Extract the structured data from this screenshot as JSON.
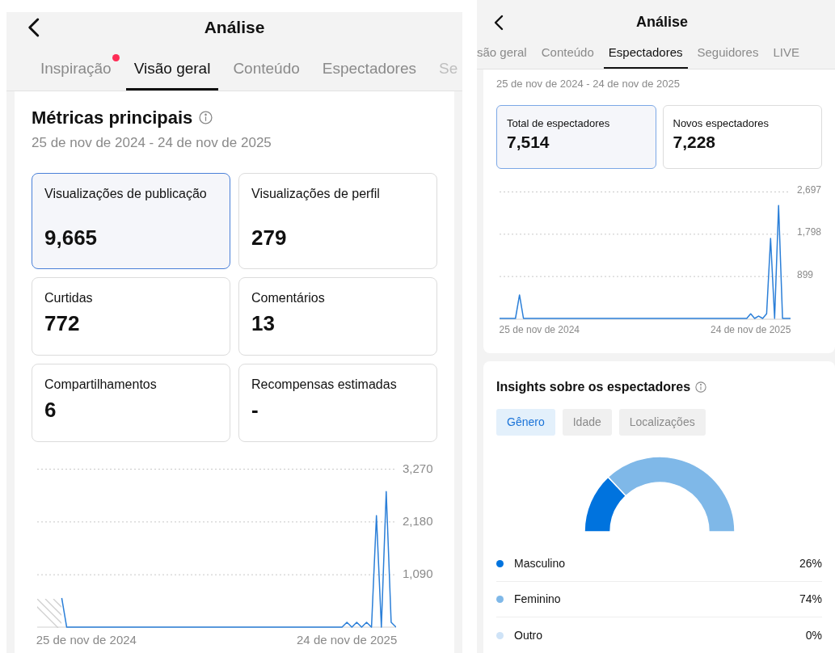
{
  "left_screen": {
    "header": {
      "title": "Análise"
    },
    "tabs": [
      {
        "label": "Inspiração",
        "selected": false,
        "badge": true
      },
      {
        "label": "Visão geral",
        "selected": true,
        "badge": false
      },
      {
        "label": "Conteúdo",
        "selected": false,
        "badge": false
      },
      {
        "label": "Espectadores",
        "selected": false,
        "badge": false
      },
      {
        "label": "Se",
        "selected": false,
        "badge": false
      }
    ],
    "section": {
      "title": "Métricas principais",
      "date_range": "25 de nov de 2024 - 24 de nov de 2025"
    },
    "metrics": [
      {
        "label": "Visualizações de publicação",
        "value": "9,665",
        "selected": true
      },
      {
        "label": "Visualizações de perfil",
        "value": "279",
        "selected": false
      },
      {
        "label": "Curtidas",
        "value": "772",
        "selected": false
      },
      {
        "label": "Comentários",
        "value": "13",
        "selected": false
      },
      {
        "label": "Compartilhamentos",
        "value": "6",
        "selected": false
      },
      {
        "label": "Recompensas estimadas",
        "value": "-",
        "selected": false
      }
    ],
    "chart_data": {
      "type": "line",
      "ylim": [
        0,
        3270
      ],
      "yticks": [
        {
          "value": 3270,
          "label": "3,270"
        },
        {
          "value": 2180,
          "label": "2,180"
        },
        {
          "value": 1090,
          "label": "1,090"
        }
      ],
      "categories": [
        null,
        null,
        null,
        null,
        null,
        null,
        null,
        null,
        null,
        null,
        "25 de nov de 2024",
        null,
        null,
        null,
        null,
        null,
        null,
        null,
        null,
        null,
        null,
        null,
        null,
        null,
        null,
        null,
        null,
        null,
        null,
        null,
        null,
        null,
        null,
        null,
        null,
        null,
        null,
        null,
        null,
        null,
        null,
        null,
        null,
        null,
        null,
        null,
        null,
        null,
        null,
        null,
        null,
        null,
        null,
        null,
        null,
        null,
        null,
        null,
        null,
        null,
        null,
        null,
        null,
        "24 de nov de 2025",
        null,
        null,
        null,
        null,
        null,
        null,
        null,
        null,
        null,
        null
      ],
      "series": [
        {
          "color": "#2b7fd8",
          "values": [
            null,
            null,
            null,
            null,
            null,
            600,
            0,
            0,
            0,
            0,
            0,
            0,
            0,
            0,
            0,
            0,
            0,
            0,
            0,
            0,
            0,
            0,
            0,
            0,
            0,
            0,
            0,
            0,
            0,
            0,
            0,
            0,
            0,
            0,
            0,
            0,
            0,
            0,
            0,
            0,
            0,
            0,
            0,
            0,
            0,
            0,
            0,
            0,
            0,
            0,
            0,
            0,
            0,
            0,
            0,
            0,
            0,
            0,
            0,
            0,
            0,
            0,
            0,
            100,
            0,
            100,
            0,
            100,
            0,
            2300,
            0,
            2800,
            100,
            0
          ]
        }
      ]
    }
  },
  "right_screen": {
    "header": {
      "title": "Análise"
    },
    "tabs": [
      {
        "label": "são geral",
        "selected": false
      },
      {
        "label": "Conteúdo",
        "selected": false
      },
      {
        "label": "Espectadores",
        "selected": true
      },
      {
        "label": "Seguidores",
        "selected": false
      },
      {
        "label": "LIVE",
        "selected": false
      }
    ],
    "date_range": "25 de nov de 2024 - 24 de nov de 2025",
    "metrics": [
      {
        "label": "Total de espectadores",
        "value": "7,514",
        "selected": true
      },
      {
        "label": "Novos espectadores",
        "value": "7,228",
        "selected": false
      }
    ],
    "chart_data": {
      "type": "line",
      "ylim": [
        0,
        2697
      ],
      "yticks": [
        {
          "value": 2697,
          "label": "2,697"
        },
        {
          "value": 1798,
          "label": "1,798"
        },
        {
          "value": 899,
          "label": "899"
        }
      ],
      "categories": [
        null,
        null,
        null,
        null,
        null,
        null,
        null,
        null,
        null,
        null,
        "25 de nov de 2024",
        null,
        null,
        null,
        null,
        null,
        null,
        null,
        null,
        null,
        null,
        null,
        null,
        null,
        null,
        null,
        null,
        null,
        null,
        null,
        null,
        null,
        null,
        null,
        null,
        null,
        null,
        null,
        null,
        null,
        null,
        null,
        null,
        null,
        null,
        null,
        null,
        null,
        null,
        null,
        null,
        null,
        null,
        null,
        null,
        null,
        null,
        null,
        null,
        null,
        null,
        null,
        null,
        "24 de nov de 2025",
        null,
        null,
        null,
        null,
        null,
        null,
        null,
        null,
        null,
        null
      ],
      "series": [
        {
          "color": "#2b7fd8",
          "values": [
            0,
            0,
            0,
            0,
            0,
            500,
            0,
            0,
            0,
            0,
            0,
            0,
            0,
            0,
            0,
            0,
            0,
            0,
            0,
            0,
            0,
            0,
            0,
            0,
            0,
            0,
            0,
            0,
            0,
            0,
            0,
            0,
            0,
            0,
            0,
            0,
            0,
            0,
            0,
            0,
            0,
            0,
            0,
            0,
            0,
            0,
            0,
            0,
            0,
            0,
            0,
            0,
            0,
            0,
            0,
            0,
            0,
            0,
            0,
            0,
            0,
            0,
            0,
            100,
            0,
            50,
            0,
            100,
            1700,
            0,
            2400,
            0,
            0,
            0
          ]
        }
      ]
    },
    "insights": {
      "title": "Insights sobre os espectadores",
      "filters": [
        {
          "label": "Gênero",
          "selected": true
        },
        {
          "label": "Idade",
          "selected": false
        },
        {
          "label": "Localizações",
          "selected": false
        }
      ],
      "chart_data": {
        "type": "donut",
        "values": [
          26,
          74,
          0
        ]
      },
      "legend": [
        {
          "label": "Masculino",
          "value": "26%",
          "color": "#0073de"
        },
        {
          "label": "Feminino",
          "value": "74%",
          "color": "#7fb8e8"
        },
        {
          "label": "Outro",
          "value": "0%",
          "color": "#cfe3f7"
        }
      ]
    }
  }
}
